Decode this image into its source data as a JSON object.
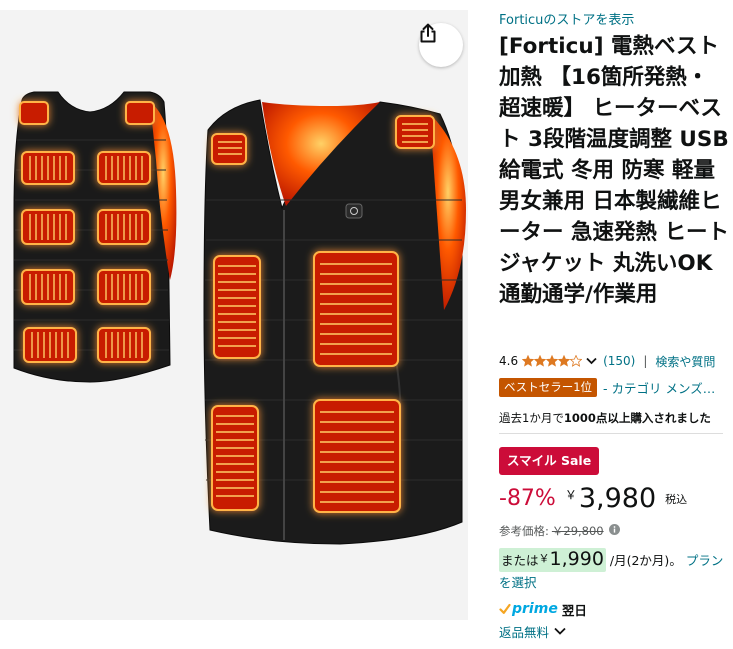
{
  "image": {
    "alt": "Forticu heated vest product image",
    "share_icon": "share-icon"
  },
  "store": {
    "link_text": "Forticuのストアを表示"
  },
  "product": {
    "title": "[Forticu] 電熱ベスト 加熱 【16箇所発熱・超速暖】 ヒーターベスト 3段階温度調整 USB給電式 冬用 防寒 軽量 男女兼用 日本製繊維ヒーター 急速発熱 ヒートジャケット 丸洗いOK 通勤通学/作業用"
  },
  "rating": {
    "value": "4.6",
    "stars": 4.5,
    "count": "(150)",
    "separator": "|",
    "qa_link": "検索や質問"
  },
  "badges": {
    "bestseller": "ベストセラー1位",
    "category": "- カテゴリ メンズ…"
  },
  "bought": {
    "prefix": "過去1か月で",
    "emphasis": "1000点以上購入されました"
  },
  "sale": {
    "label": "スマイル Sale"
  },
  "price": {
    "discount": "-87%",
    "currency": "￥",
    "amount": "3,980",
    "tax_label": "税込"
  },
  "reference": {
    "label": "参考価格:",
    "price": "￥29,800"
  },
  "installment": {
    "prefix": "または",
    "currency": "￥",
    "amount": "1,990",
    "suffix": " /月(2か月)。",
    "link": "プランを選択"
  },
  "prime": {
    "label": "prime",
    "delivery": "翌日"
  },
  "returns": {
    "label": "返品無料"
  },
  "colors": {
    "link": "#007185",
    "deal_red": "#cc0c39",
    "bestseller_orange": "#c45500",
    "prime_blue": "#00a8e1",
    "installment_green": "#cef0d5",
    "star_orange": "#de7921"
  }
}
